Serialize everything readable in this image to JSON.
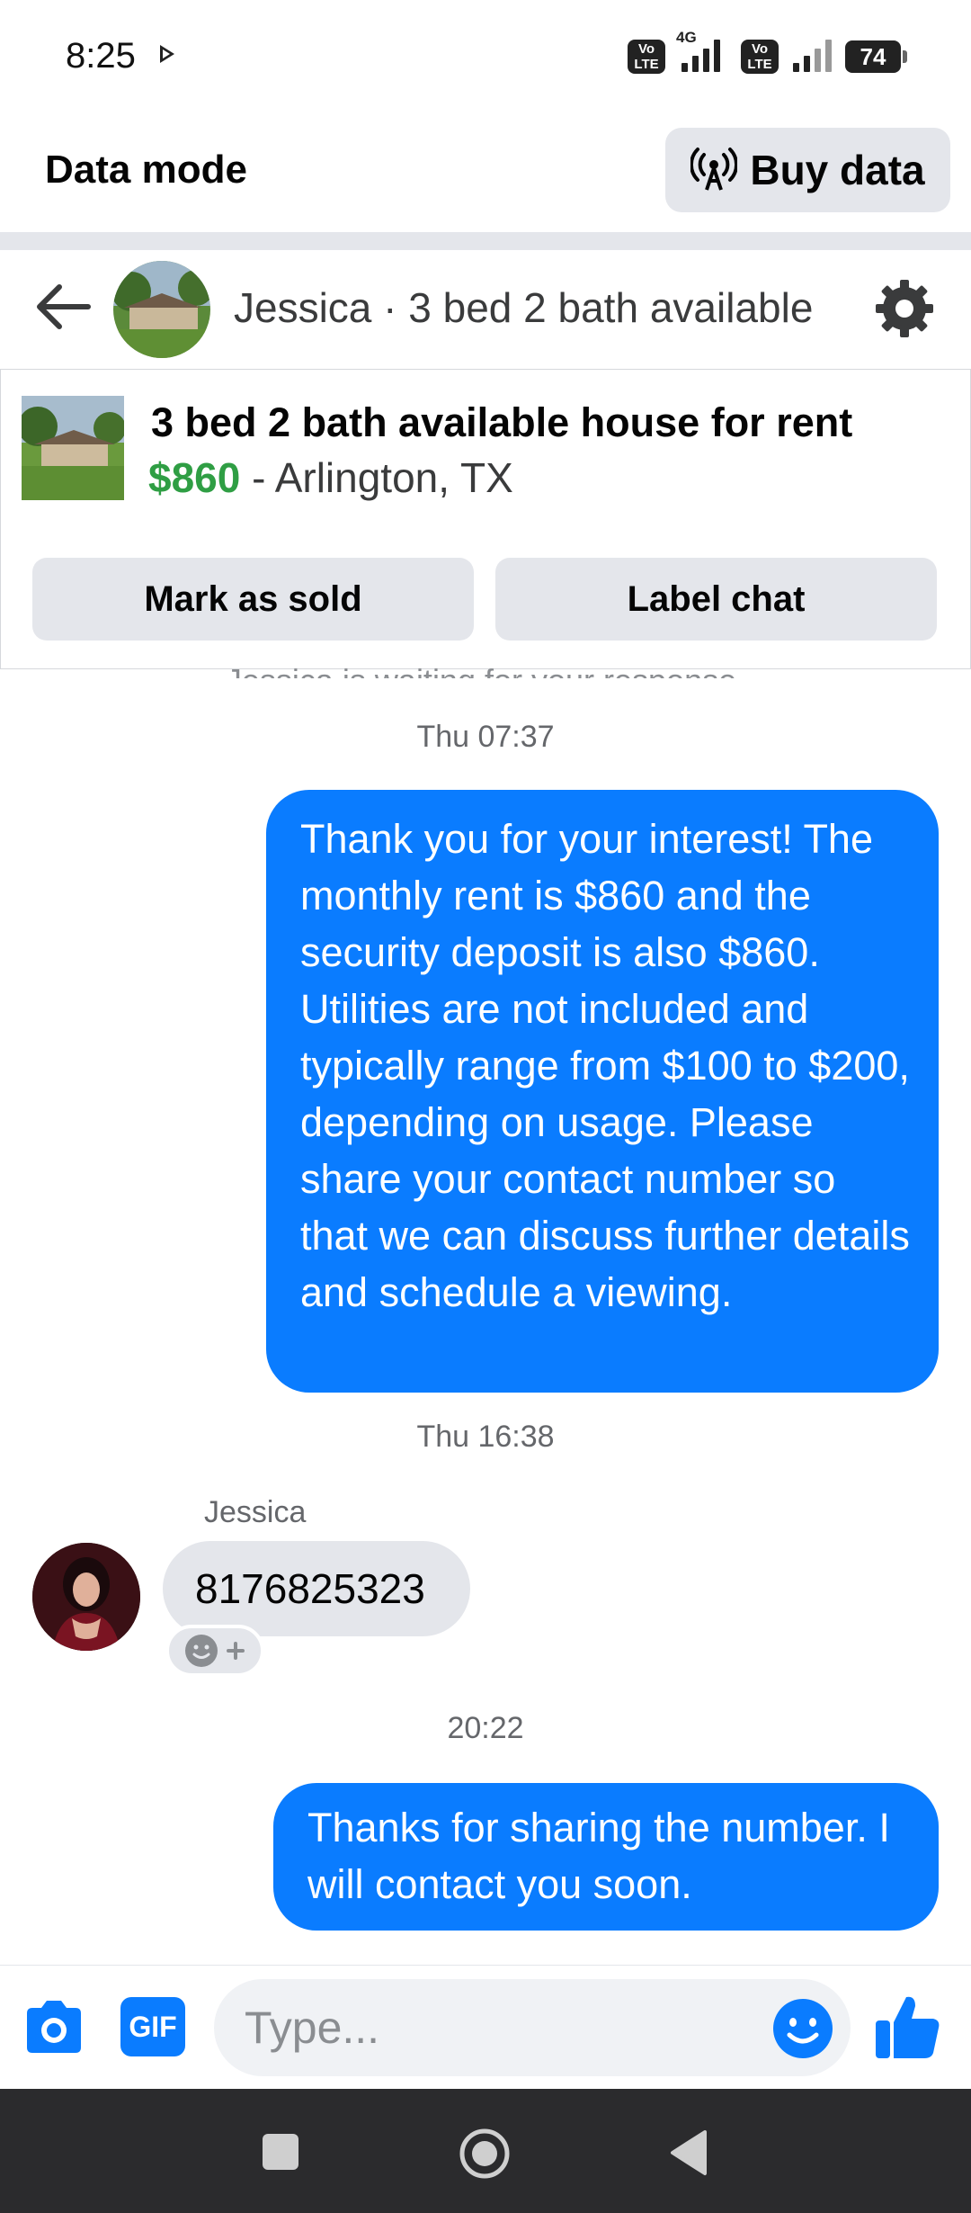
{
  "status_bar": {
    "time": "8:25",
    "network_label": "4G",
    "volte_1": "Vo LTE",
    "volte_2": "Vo LTE",
    "battery": "74"
  },
  "data_mode": {
    "title": "Data mode",
    "buy_label": "Buy data",
    "buy_icon": "broadcast-tower-icon"
  },
  "header": {
    "title": "Jessica · 3 bed 2 bath available",
    "back_icon": "arrow-left-icon",
    "settings_icon": "gear-icon"
  },
  "listing": {
    "title": "3 bed 2 bath available house for rent",
    "price": "$860",
    "separator": " - ",
    "location": "Arlington, TX",
    "mark_sold_label": "Mark as sold",
    "label_chat_label": "Label chat"
  },
  "conversation": {
    "waiting_text": "Jessica is waiting for your response.",
    "timestamp_1": "Thu 07:37",
    "message_1": "Thank you for your interest! The monthly rent is $860 and the security deposit is also $860. Utilities are not included and typically range from $100 to $200, depending on usage. Please share your contact number so that we can discuss further details and schedule a viewing.",
    "timestamp_2": "Thu 16:38",
    "sender_name": "Jessica",
    "incoming_message": "8176825323",
    "timestamp_3": "20:22",
    "message_2": "Thanks for sharing the number. I will contact you soon."
  },
  "composer": {
    "placeholder": "Type...",
    "gif_label": "GIF",
    "camera_icon": "camera-icon",
    "emoji_icon": "smiley-icon",
    "like_icon": "thumbs-up-icon"
  },
  "colors": {
    "accent": "#0a7cff",
    "price_green": "#2f9e44",
    "bubble_gray": "#e4e6eb"
  }
}
